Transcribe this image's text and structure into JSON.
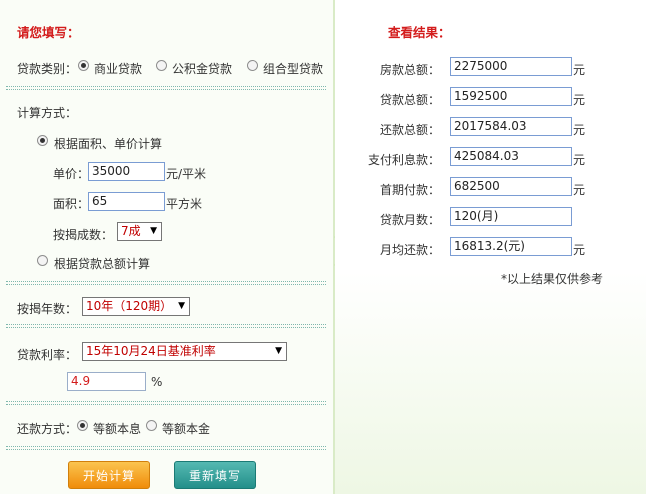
{
  "form": {
    "title": "请您填写：",
    "loan_type": {
      "label": "贷款类别：",
      "options": [
        "商业贷款",
        "公积金贷款",
        "组合型贷款"
      ],
      "selected": 0
    },
    "calc_method": {
      "label": "计算方式：",
      "option_area": "根据面积、单价计算",
      "option_total": "根据贷款总额计算",
      "unit_price_label": "单价：",
      "unit_price_value": "35000",
      "unit_price_unit": "元/平米",
      "area_label": "面积：",
      "area_value": "65",
      "area_unit": "平方米",
      "ratio_label": "按揭成数：",
      "ratio_value": "7成"
    },
    "years": {
      "label": "按揭年数：",
      "value": "10年（120期）"
    },
    "rate": {
      "label": "贷款利率：",
      "value": "15年10月24日基准利率",
      "percent": "4.9",
      "percent_unit": "%"
    },
    "repay": {
      "label": "还款方式：",
      "options": [
        "等额本息",
        "等额本金"
      ],
      "selected": 0
    },
    "buttons": {
      "calc": "开始计算",
      "reset": "重新填写"
    }
  },
  "result": {
    "title": "查看结果：",
    "rows": [
      {
        "label": "房款总额：",
        "value": "2275000",
        "unit": "元"
      },
      {
        "label": "贷款总额：",
        "value": "1592500",
        "unit": "元"
      },
      {
        "label": "还款总额：",
        "value": "2017584.03",
        "unit": "元"
      },
      {
        "label": "支付利息款：",
        "value": "425084.03",
        "unit": "元"
      },
      {
        "label": "首期付款：",
        "value": "682500",
        "unit": "元"
      },
      {
        "label": "贷款月数：",
        "value": "120(月)",
        "unit": ""
      },
      {
        "label": "月均还款：",
        "value": "16813.2(元)",
        "unit": "元"
      }
    ],
    "note": "*以上结果仅供参考"
  },
  "colors": {
    "title": "#d31c1c",
    "divider": "#d9ebc7",
    "separator": "#7fb7ad"
  },
  "icons": {
    "arrow": "double-chevron-right-icon"
  }
}
